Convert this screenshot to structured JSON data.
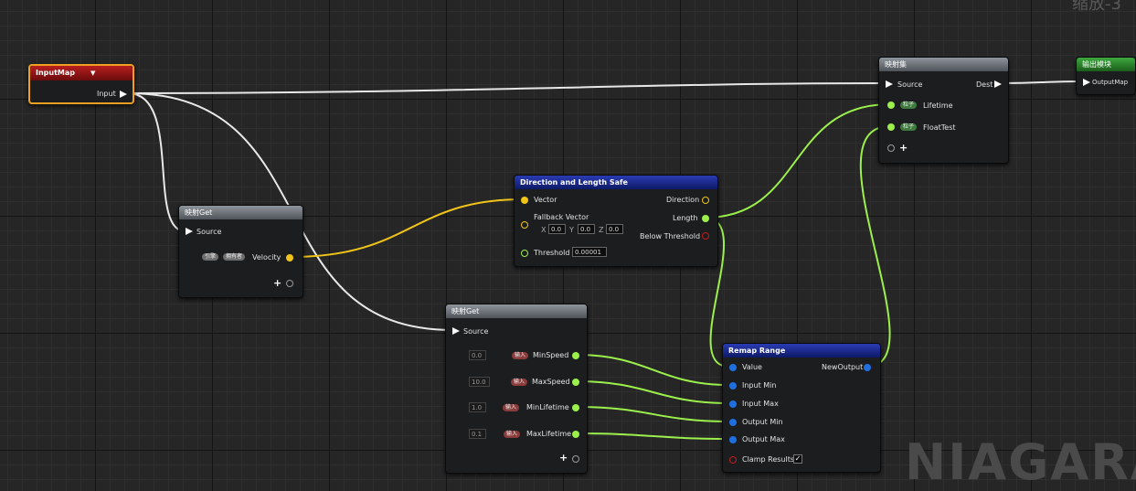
{
  "graph": {
    "zoom_label": "缩放-3",
    "watermark": "NIAGARA"
  },
  "nodes": {
    "input_map": {
      "title": "InputMap",
      "output": "Input"
    },
    "get1": {
      "title": "映射Get",
      "source": "Source",
      "badge1": "引擎",
      "badge2": "拥有者",
      "output": "Velocity"
    },
    "dir_len": {
      "title": "Direction and Length Safe",
      "vector": "Vector",
      "fallback": "Fallback Vector",
      "x_label": "X",
      "x_val": "0.0",
      "y_label": "Y",
      "y_val": "0.0",
      "z_label": "Z",
      "z_val": "0.0",
      "threshold": "Threshold",
      "threshold_val": "0.00001",
      "direction": "Direction",
      "length": "Length",
      "below_threshold": "Below Threshold"
    },
    "get2": {
      "title": "映射Get",
      "source": "Source",
      "rows": [
        {
          "default": "0.0",
          "badge": "输入",
          "label": "MinSpeed"
        },
        {
          "default": "10.0",
          "badge": "输入",
          "label": "MaxSpeed"
        },
        {
          "default": "1.0",
          "badge": "输入",
          "label": "MinLifetime"
        },
        {
          "default": "0.1",
          "badge": "输入",
          "label": "MaxLifetime"
        }
      ]
    },
    "remap": {
      "title": "Remap Range",
      "value": "Value",
      "input_min": "Input Min",
      "input_max": "Input Max",
      "output_min": "Output Min",
      "output_max": "Output Max",
      "clamp": "Clamp Results",
      "clamp_checked": "✓",
      "new_output": "NewOutput"
    },
    "set": {
      "title": "映射集",
      "source": "Source",
      "dest": "Dest",
      "row1_badge": "粒子",
      "row1_label": "Lifetime",
      "row2_badge": "粒子",
      "row2_label": "FloatTest"
    },
    "output": {
      "title": "输出模块",
      "input": "OutputMap"
    }
  },
  "colors": {
    "float_wire": "#9cf04c",
    "vector_wire": "#f0c419",
    "map_wire": "#e8e8e8",
    "selected_border": "#f0a020"
  }
}
